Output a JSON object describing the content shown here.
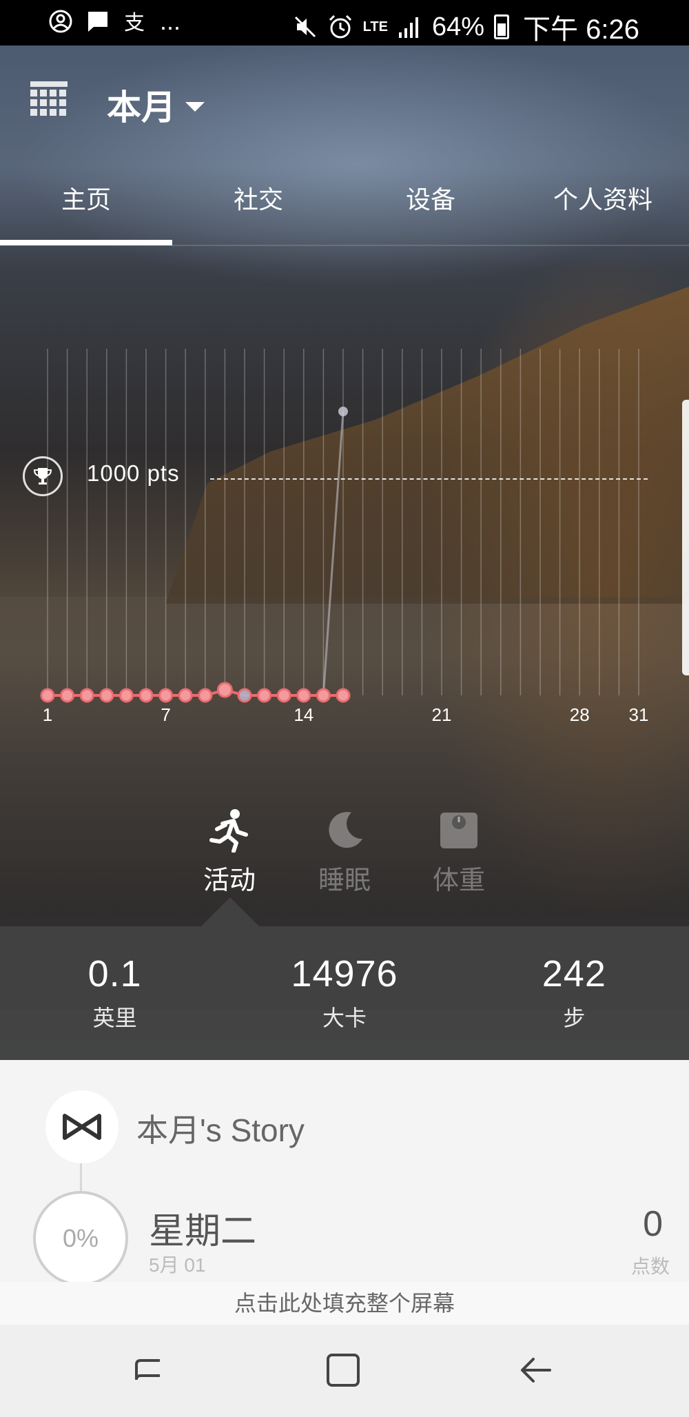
{
  "status_bar": {
    "left_icons": [
      "account-circle-icon",
      "message-icon",
      "alipay-icon"
    ],
    "left_more": "...",
    "lte": "LTE",
    "battery": "64%",
    "time": "下午 6:26",
    "right_icons": [
      "mute-icon",
      "alarm-icon",
      "signal-icon",
      "battery-icon"
    ]
  },
  "header": {
    "title": "本月",
    "calendar_icon": "calendar-grid-icon"
  },
  "tabs": [
    {
      "label": "主页",
      "active": true
    },
    {
      "label": "社交",
      "active": false
    },
    {
      "label": "设备",
      "active": false
    },
    {
      "label": "个人资料",
      "active": false
    }
  ],
  "chart_data": {
    "type": "line",
    "goal_label": "1000   pts",
    "goal_value": 1000,
    "x_ticks": [
      "1",
      "7",
      "14",
      "21",
      "28",
      "31"
    ],
    "x_range": [
      1,
      31
    ],
    "y_range": [
      0,
      1000
    ],
    "days": [
      1,
      2,
      3,
      4,
      5,
      6,
      7,
      8,
      9,
      10,
      11,
      12,
      13,
      14,
      15,
      16
    ],
    "values": [
      0,
      0,
      0,
      0,
      0,
      0,
      0,
      0,
      0,
      20,
      0,
      0,
      0,
      0,
      0,
      1000
    ],
    "current_day": 16,
    "color": "#ec6b70"
  },
  "modes": [
    {
      "label": "活动",
      "icon": "running-icon",
      "active": true
    },
    {
      "label": "睡眠",
      "icon": "moon-icon",
      "active": false
    },
    {
      "label": "体重",
      "icon": "scale-icon",
      "active": false
    }
  ],
  "stats": [
    {
      "value": "0.1",
      "unit": "英里"
    },
    {
      "value": "14976",
      "unit": "大卡"
    },
    {
      "value": "242",
      "unit": "步"
    }
  ],
  "story": {
    "title": "本月's Story",
    "percent": "0%",
    "day_name": "星期二",
    "date": "5月 01",
    "points": "0",
    "points_label": "点数"
  },
  "fill_hint": "点击此处填充整个屏幕",
  "nav": {
    "recent_icon": "recent-apps-icon",
    "home_icon": "home-icon",
    "back_icon": "back-icon"
  }
}
